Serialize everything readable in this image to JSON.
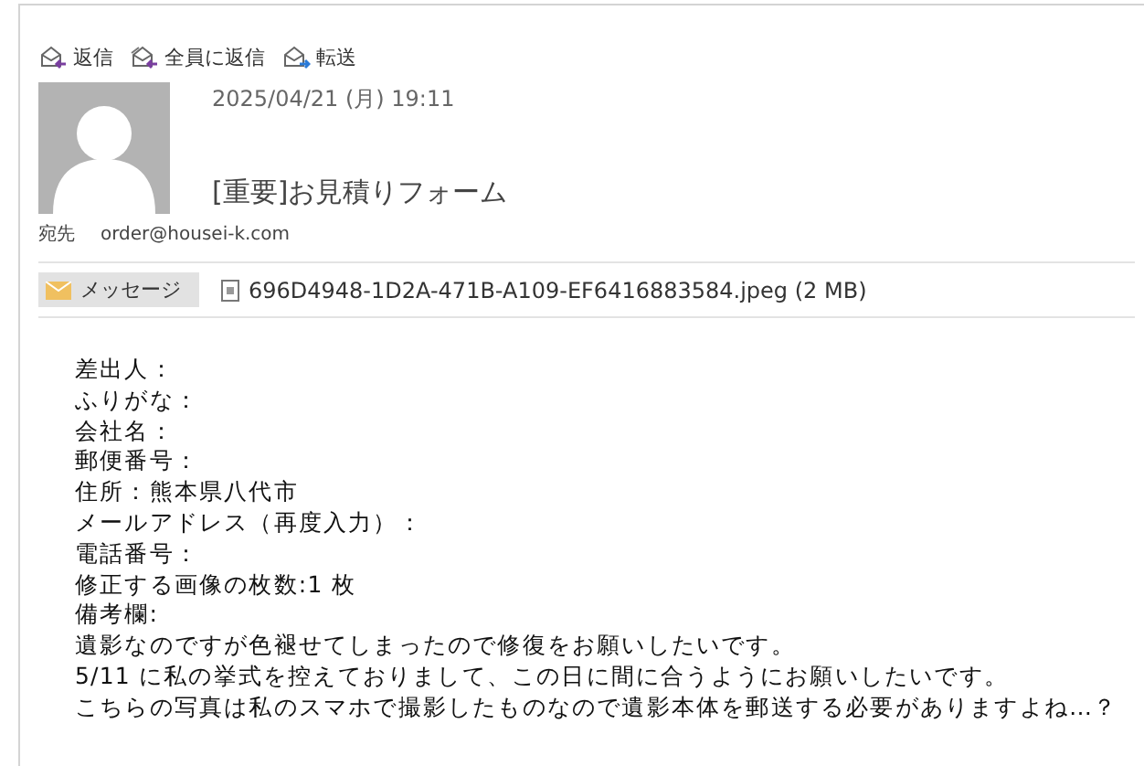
{
  "actions": [
    {
      "kind": "reply",
      "label": "返信"
    },
    {
      "kind": "reply_all",
      "label": "全員に返信"
    },
    {
      "kind": "forward",
      "label": "転送"
    }
  ],
  "message": {
    "date": "2025/04/21 (月) 19:11",
    "subject": "[重要]お見積りフォーム",
    "to_label": "宛先",
    "to": "order@housei-k.com"
  },
  "attachments": [
    {
      "kind": "message",
      "label": "メッセージ",
      "selected": true
    },
    {
      "kind": "file",
      "label": "696D4948-1D2A-471B-A109-EF6416883584.jpeg (2 MB)",
      "selected": false
    }
  ],
  "body": [
    "差出人：",
    "ふりがな：",
    "会社名：",
    "郵便番号：",
    "住所：熊本県八代市",
    "メールアドレス（再度入力）：",
    "電話番号：",
    "修正する画像の枚数:1 枚",
    "備考欄:",
    "遺影なのですが色褪せてしまったので修復をお願いしたいです。",
    "5/11 に私の挙式を控えておりまして、この日に間に合うようにお願いしたいです。",
    "こちらの写真は私のスマホで撮影したものなので遺影本体を郵送する必要がありますよね…？"
  ]
}
